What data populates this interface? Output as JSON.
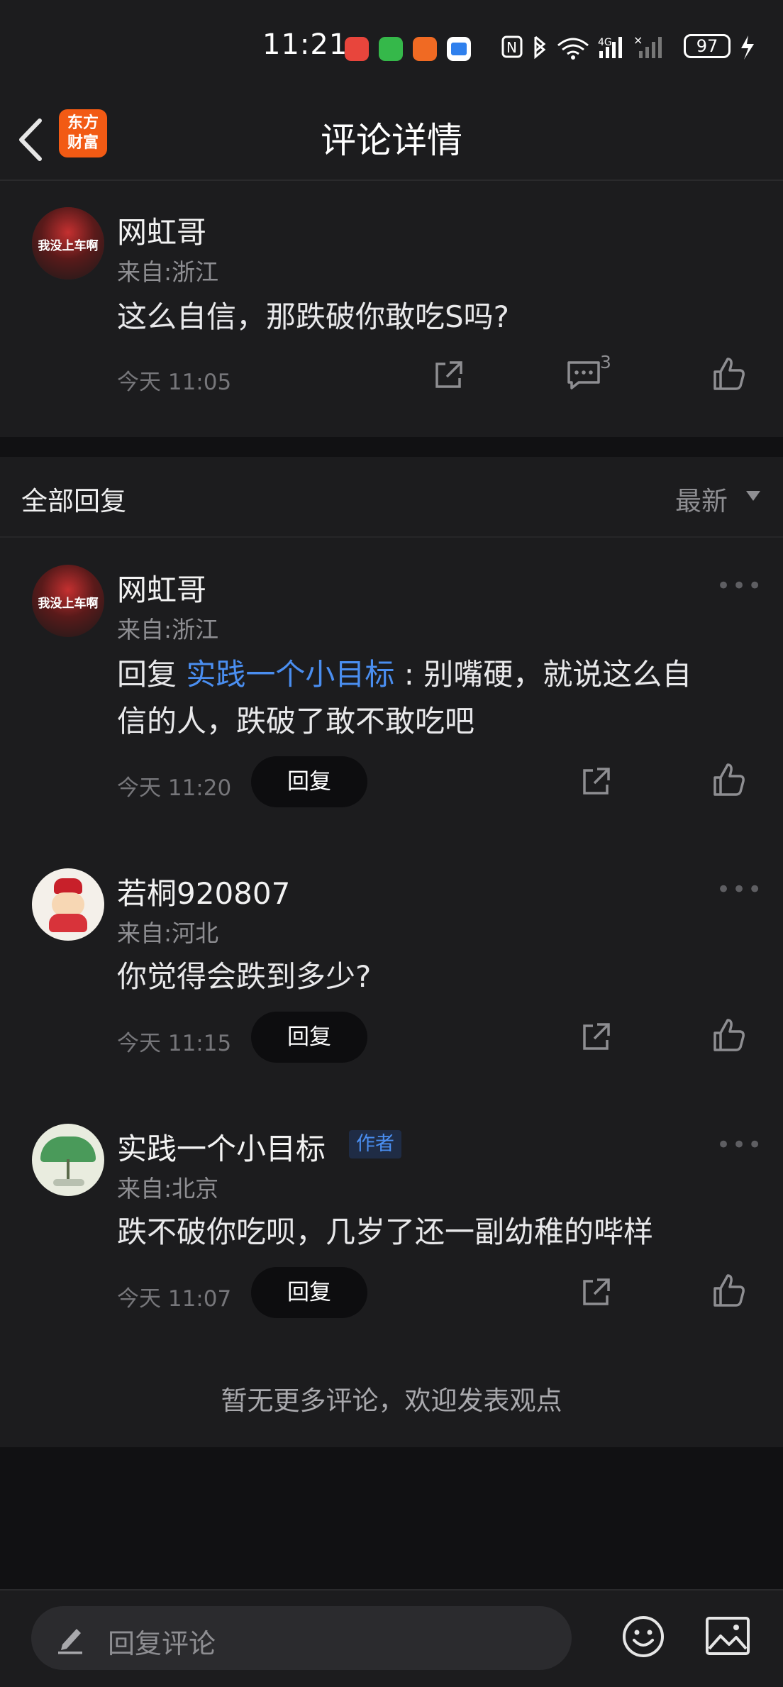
{
  "status_bar": {
    "time": "11:21",
    "battery": "97",
    "apps": [
      {
        "name": "app-icon-red",
        "color": "#e8453c"
      },
      {
        "name": "phone-icon",
        "color": "#35b84a"
      },
      {
        "name": "app-icon-orange",
        "color": "#f06a23"
      },
      {
        "name": "calendar-icon",
        "color": "#2f80ed"
      }
    ]
  },
  "header": {
    "title": "评论详情",
    "logo_line1": "东方",
    "logo_line2": "财富"
  },
  "main_comment": {
    "avatar_text": "我没上车啊",
    "name": "网虹哥",
    "location": "来自:浙江",
    "text": "这么自信，那跌破你敢吃S吗?",
    "time": "今天 11:05",
    "comment_count": "3"
  },
  "replies_section": {
    "title": "全部回复",
    "sort_label": "最新"
  },
  "replies": [
    {
      "avatar_text": "我没上车啊",
      "name": "网虹哥",
      "location": "来自:浙江",
      "reply_prefix": "回复 ",
      "reply_to": "实践一个小目标",
      "text_line1": " : 别嘴硬，就说这么自",
      "text_line2": "信的人，跌破了敢不敢吃吧",
      "time": "今天 11:20",
      "reply_button": "回复",
      "more": "•••"
    },
    {
      "name": "若桐920807",
      "location": "来自:河北",
      "text": "你觉得会跌到多少?",
      "time": "今天 11:15",
      "reply_button": "回复",
      "more": "•••"
    },
    {
      "name": "实践一个小目标",
      "badge": "作者",
      "location": "来自:北京",
      "text": "跌不破你吃呗，几岁了还一副幼稚的哔样",
      "time": "今天 11:07",
      "reply_button": "回复",
      "more": "•••"
    }
  ],
  "footer_note": "暂无更多评论，欢迎发表观点",
  "bottom_bar": {
    "input_placeholder": "回复评论"
  }
}
